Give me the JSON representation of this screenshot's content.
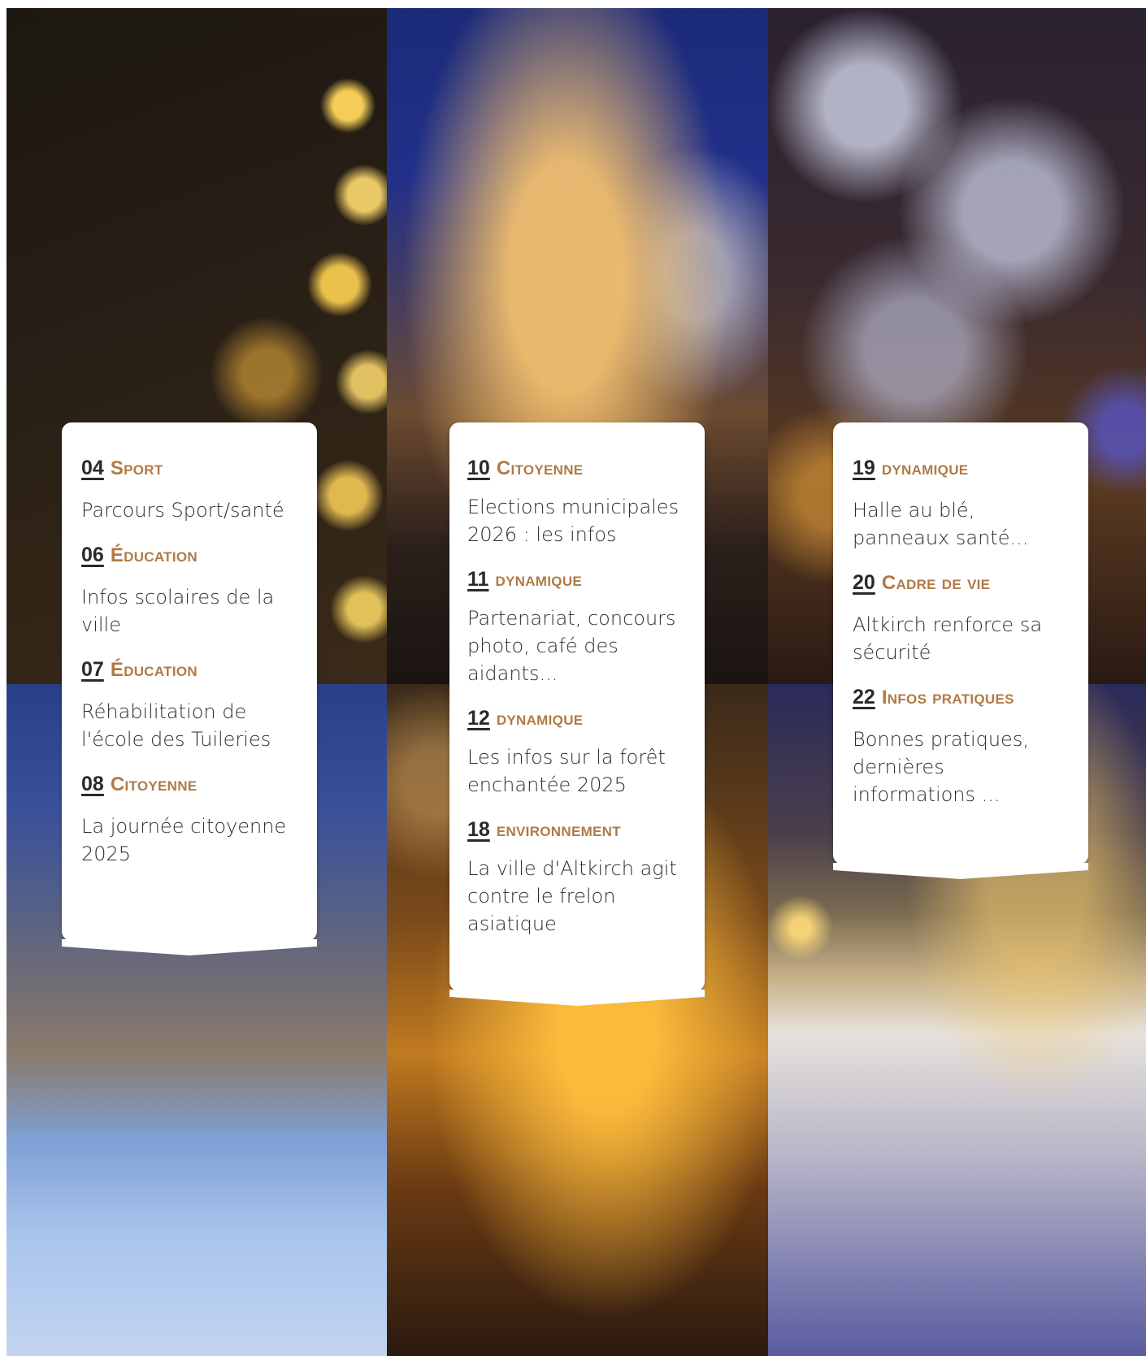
{
  "photos": [
    {
      "id": "t1",
      "subject": "Golden bokeh lights and illuminated figure at night"
    },
    {
      "id": "t2",
      "subject": "Illuminated town hall building at dusk"
    },
    {
      "id": "t3",
      "subject": "Blue and white fairy lights bokeh"
    },
    {
      "id": "t4",
      "subject": "Outdoor ice rink in town square at dusk"
    },
    {
      "id": "t5",
      "subject": "String lights on tree branches at night"
    },
    {
      "id": "t6",
      "subject": "Family ice skating at night"
    }
  ],
  "colors": {
    "category": "#b07a45",
    "number": "#2a2a2a",
    "text": "#2e2e2e",
    "card": "#ffffff"
  },
  "cards": [
    {
      "entries": [
        {
          "num": "04",
          "cat": "Sport",
          "desc": "Parcours Sport/santé"
        },
        {
          "num": "06",
          "cat": "Éducation",
          "desc": "Infos scolaires de la ville"
        },
        {
          "num": "07",
          "cat": "Éducation",
          "desc": "Réhabilitation de l'école des Tuileries"
        },
        {
          "num": "08",
          "cat": "Citoyenne",
          "desc": "La journée citoyenne 2025"
        }
      ]
    },
    {
      "entries": [
        {
          "num": "10",
          "cat": "Citoyenne",
          "desc": "Elections municipales 2026 : les infos"
        },
        {
          "num": "11",
          "cat": "dynamique",
          "desc": "Partenariat, concours photo, café des aidants..."
        },
        {
          "num": "12",
          "cat": "dynamique",
          "desc": "Les infos sur la forêt enchantée 2025"
        },
        {
          "num": "18",
          "cat": "environnement",
          "desc": "La ville d'Altkirch agit contre le frelon asiatique"
        }
      ]
    },
    {
      "entries": [
        {
          "num": "19",
          "cat": "dynamique",
          "desc": "Halle au blé, panneaux santé..."
        },
        {
          "num": "20",
          "cat": "Cadre de vie",
          "desc": "Altkirch renforce sa sécurité"
        },
        {
          "num": "22",
          "cat": "Infos pratiques",
          "desc": "Bonnes pratiques, dernières informations ..."
        }
      ]
    }
  ]
}
